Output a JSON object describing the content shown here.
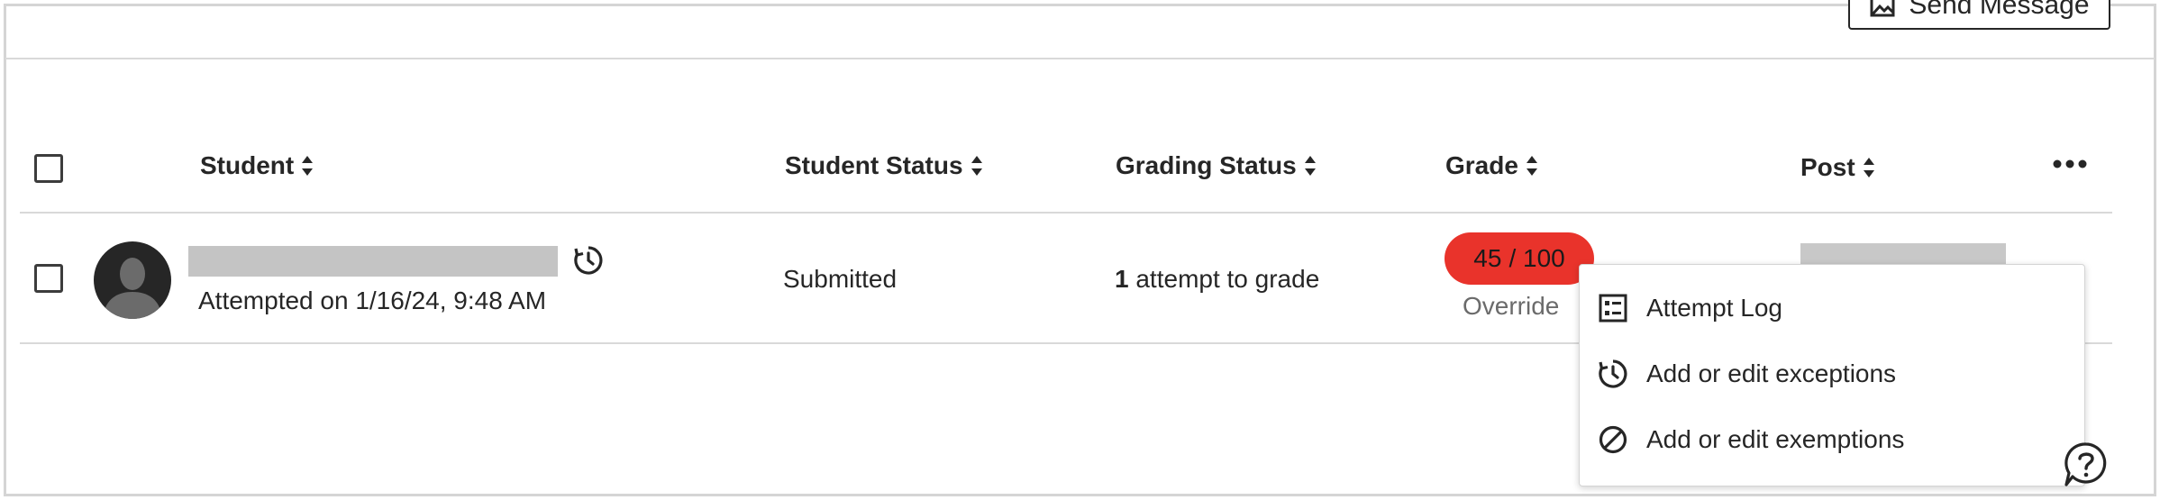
{
  "toolbar": {
    "send_message_label": "Send Message"
  },
  "table": {
    "headers": {
      "student": "Student",
      "student_status": "Student Status",
      "grading_status": "Grading Status",
      "grade": "Grade",
      "post": "Post"
    },
    "rows": [
      {
        "attempted": "Attempted on 1/16/24, 9:48 AM",
        "student_status": "Submitted",
        "grading_count": "1",
        "grading_suffix": "attempt to grade",
        "grade_score": "45",
        "grade_total": "/ 100",
        "grade_note": "Override"
      }
    ]
  },
  "menu": {
    "items": [
      {
        "label": "Attempt Log",
        "icon": "checklist-icon"
      },
      {
        "label": "Add or edit exceptions",
        "icon": "clock-icon"
      },
      {
        "label": "Add or edit exemptions",
        "icon": "prohibited-icon"
      }
    ]
  },
  "colors": {
    "grade_pill": "#e9332b",
    "border": "#d9d9d9",
    "placeholder": "#c4c4c4"
  }
}
